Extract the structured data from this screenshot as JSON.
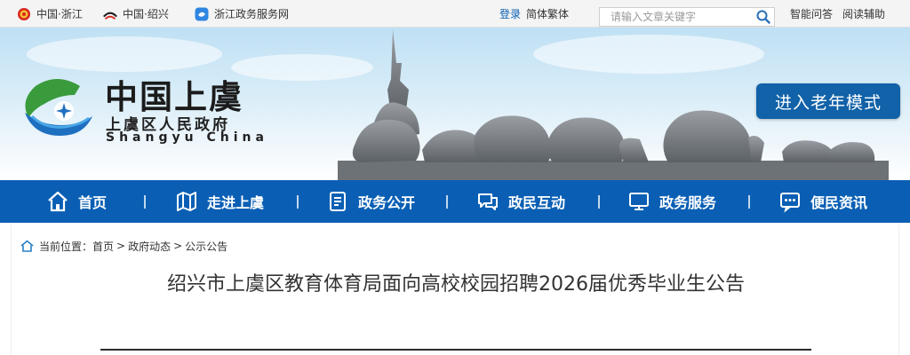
{
  "topbar": {
    "links": [
      {
        "label": "中国·浙江",
        "icon": "national-emblem-icon"
      },
      {
        "label": "中国·绍兴",
        "icon": "shaoxing-logo-icon"
      },
      {
        "label": "浙江政务服务网",
        "icon": "zhejiang-gov-service-icon"
      }
    ],
    "login": "登录",
    "language": "简体繁体",
    "search": {
      "placeholder": "请输入文章关键字",
      "value": "",
      "icon": "search-icon"
    },
    "right_links": [
      "智能问答",
      "阅读辅助"
    ]
  },
  "header": {
    "site_name": "中国上虞",
    "site_subtitle": "上虞区人民政府",
    "site_subtitle_en": "Shangyu China",
    "elder_mode": "进入老年模式",
    "accent_color": "#0a5fb4"
  },
  "nav": {
    "items": [
      {
        "label": "首页",
        "icon": "home-icon"
      },
      {
        "label": "走进上虞",
        "icon": "map-icon"
      },
      {
        "label": "政务公开",
        "icon": "document-icon"
      },
      {
        "label": "政民互动",
        "icon": "chat-bubbles-icon"
      },
      {
        "label": "政务服务",
        "icon": "monitor-icon"
      },
      {
        "label": "便民资讯",
        "icon": "message-icon"
      }
    ]
  },
  "breadcrumb": {
    "prefix": "当前位置：",
    "items": [
      "首页",
      "政府动态",
      "公示公告"
    ],
    "separator": ">"
  },
  "article": {
    "title": "绍兴市上虞区教育体育局面向高校校园招聘2026届优秀毕业生公告"
  }
}
